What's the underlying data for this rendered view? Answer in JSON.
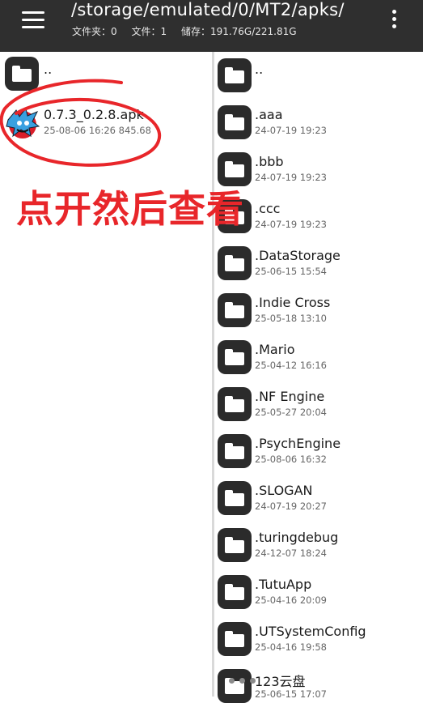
{
  "header": {
    "path": "/storage/emulated/0/MT2/apks/",
    "folders_label": "文件夹：0",
    "files_label": "文件：1",
    "storage_label": "储存：191.76G/221.81G"
  },
  "left": {
    "parent": "..",
    "file": {
      "name": "0.7.3_0.2.8.apk",
      "meta": "25-08-06 16:26  845.68"
    }
  },
  "annotation": {
    "text": "点开然后查看",
    "color": "#e8262a"
  },
  "right": {
    "parent": "..",
    "items": [
      {
        "name": ".aaa",
        "date": "24-07-19 19:23"
      },
      {
        "name": ".bbb",
        "date": "24-07-19 19:23"
      },
      {
        "name": ".ccc",
        "date": "24-07-19 19:23"
      },
      {
        "name": ".DataStorage",
        "date": "25-06-15 15:54"
      },
      {
        "name": ".Indie Cross",
        "date": "25-05-18 13:10"
      },
      {
        "name": ".Mario",
        "date": "25-04-12 16:16"
      },
      {
        "name": ".NF Engine",
        "date": "25-05-27 20:04"
      },
      {
        "name": ".PsychEngine",
        "date": "25-08-06 16:32"
      },
      {
        "name": ".SLOGAN",
        "date": "24-07-19 20:27"
      },
      {
        "name": ".turingdebug",
        "date": "24-12-07 18:24"
      },
      {
        "name": ".TutuApp",
        "date": "25-04-16 20:09"
      },
      {
        "name": ".UTSystemConfig",
        "date": "25-04-16 19:58"
      },
      {
        "name": "123云盘",
        "date": "25-06-15 17:07"
      }
    ]
  },
  "icons": {
    "menu": "hamburger-icon",
    "more": "more-vertical-icon",
    "folder": "folder-icon",
    "apk": "apk-app-icon"
  }
}
